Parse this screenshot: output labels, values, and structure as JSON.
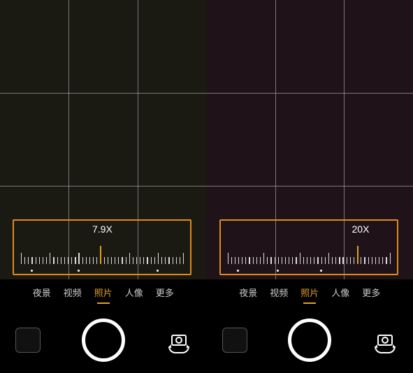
{
  "panels": {
    "left": {
      "zoom_label": "7.9X",
      "modes": [
        {
          "label": "夜景",
          "active": false
        },
        {
          "label": "视频",
          "active": false
        },
        {
          "label": "照片",
          "active": true
        },
        {
          "label": "人像",
          "active": false
        },
        {
          "label": "更多",
          "active": false
        }
      ]
    },
    "right": {
      "zoom_label": "20X",
      "modes": [
        {
          "label": "夜景",
          "active": false
        },
        {
          "label": "视频",
          "active": false
        },
        {
          "label": "照片",
          "active": true
        },
        {
          "label": "人像",
          "active": false
        },
        {
          "label": "更多",
          "active": false
        }
      ]
    }
  },
  "colors": {
    "accent": "#e0a02a",
    "box_border": "#e08a1e"
  }
}
